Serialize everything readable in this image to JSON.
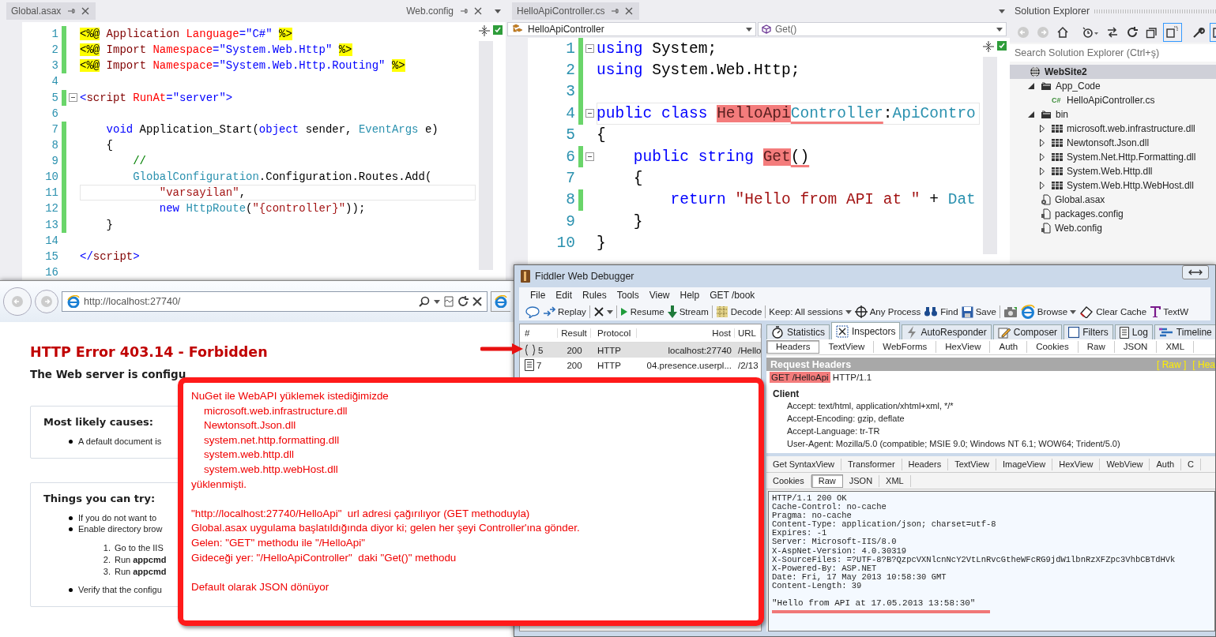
{
  "editor_left": {
    "tabs": [
      {
        "label": "Global.asax",
        "selected": true
      },
      {
        "label": "Web.config",
        "selected": false
      }
    ],
    "lines": [
      {
        "number": "1",
        "changed": true,
        "fold": false,
        "current": false,
        "tokens": [
          {
            "kind": "dir",
            "text": "<%@"
          },
          {
            "kind": "tag",
            "text": " Application "
          },
          {
            "kind": "attr",
            "text": "Language"
          },
          {
            "kind": "str",
            "text": "=\"C#\" "
          },
          {
            "kind": "dir",
            "text": "%>"
          }
        ]
      },
      {
        "number": "2",
        "changed": true,
        "fold": false,
        "current": false,
        "tokens": [
          {
            "kind": "dir",
            "text": "<%@"
          },
          {
            "kind": "tag",
            "text": " Import "
          },
          {
            "kind": "attr",
            "text": "Namespace"
          },
          {
            "kind": "str",
            "text": "=\"System.Web.Http\" "
          },
          {
            "kind": "dir",
            "text": "%>"
          }
        ]
      },
      {
        "number": "3",
        "changed": true,
        "fold": false,
        "current": false,
        "tokens": [
          {
            "kind": "dir",
            "text": "<%@"
          },
          {
            "kind": "tag",
            "text": " Import "
          },
          {
            "kind": "attr",
            "text": "Namespace"
          },
          {
            "kind": "str",
            "text": "=\"System.Web.Http.Routing\" "
          },
          {
            "kind": "dir",
            "text": "%>"
          }
        ]
      },
      {
        "number": "4",
        "changed": false,
        "fold": false,
        "current": false
      },
      {
        "number": "5",
        "changed": true,
        "fold": true,
        "current": false,
        "tokens": [
          {
            "kind": "str",
            "text": "<"
          },
          {
            "kind": "tag",
            "text": "script"
          },
          {
            "kind": "attr",
            "text": " RunAt"
          },
          {
            "kind": "str",
            "text": "=\"server\">"
          }
        ]
      },
      {
        "number": "6",
        "changed": false,
        "fold": false,
        "current": false
      },
      {
        "number": "7",
        "changed": true,
        "fold": false,
        "current": false,
        "tokens": [
          {
            "kind": "kw",
            "text": "    void"
          },
          {
            "kind": "plain",
            "text": " Application_Start("
          },
          {
            "kind": "kw",
            "text": "object"
          },
          {
            "kind": "plain",
            "text": " sender, "
          },
          {
            "kind": "type",
            "text": "EventArgs"
          },
          {
            "kind": "plain",
            "text": " e)"
          }
        ]
      },
      {
        "number": "8",
        "changed": true,
        "fold": false,
        "current": false,
        "tokens": [
          {
            "kind": "plain",
            "text": "    {"
          }
        ]
      },
      {
        "number": "9",
        "changed": true,
        "fold": false,
        "current": false,
        "tokens": [
          {
            "kind": "comment",
            "text": "        //"
          }
        ]
      },
      {
        "number": "10",
        "changed": true,
        "fold": false,
        "current": false,
        "tokens": [
          {
            "kind": "type",
            "text": "        GlobalConfiguration"
          },
          {
            "kind": "plain",
            "text": ".Configuration.Routes.Add("
          }
        ]
      },
      {
        "number": "11",
        "changed": true,
        "fold": false,
        "current": true,
        "tokens": [
          {
            "kind": "cstr",
            "text": "            \"varsayilan\""
          },
          {
            "kind": "plain",
            "text": ","
          }
        ]
      },
      {
        "number": "12",
        "changed": true,
        "fold": false,
        "current": false,
        "tokens": [
          {
            "kind": "kw",
            "text": "            new "
          },
          {
            "kind": "type",
            "text": "HttpRoute"
          },
          {
            "kind": "plain",
            "text": "("
          },
          {
            "kind": "cstr",
            "text": "\"{controller}\""
          },
          {
            "kind": "plain",
            "text": "));"
          }
        ]
      },
      {
        "number": "13",
        "changed": true,
        "fold": false,
        "current": false,
        "tokens": [
          {
            "kind": "plain",
            "text": "    }"
          }
        ]
      },
      {
        "number": "14",
        "changed": false,
        "fold": false,
        "current": false
      },
      {
        "number": "15",
        "changed": false,
        "fold": false,
        "current": false,
        "tokens": [
          {
            "kind": "str",
            "text": "</"
          },
          {
            "kind": "tag",
            "text": "script"
          },
          {
            "kind": "str",
            "text": ">"
          }
        ]
      },
      {
        "number": "16",
        "changed": false,
        "fold": false,
        "current": false
      }
    ]
  },
  "editor_right": {
    "tabs": [
      {
        "label": "HelloApiController.cs",
        "selected": true
      }
    ],
    "type_selector": "HelloApiController",
    "member_selector": "Get()",
    "lines": [
      {
        "number": "1",
        "changed": true,
        "fold": true,
        "current": false,
        "tokens": [
          {
            "kind": "kw",
            "text": "using"
          },
          {
            "kind": "plain",
            "text": " System;"
          }
        ]
      },
      {
        "number": "2",
        "changed": true,
        "fold": false,
        "current": false,
        "tokens": [
          {
            "kind": "kw",
            "text": "using"
          },
          {
            "kind": "plain",
            "text": " System.Web.Http;"
          }
        ]
      },
      {
        "number": "3",
        "changed": true,
        "fold": false,
        "current": false
      },
      {
        "number": "4",
        "changed": true,
        "fold": true,
        "current": true,
        "tokens": [
          {
            "kind": "kw",
            "text": "public class "
          },
          {
            "kind": "mark",
            "text": "HelloApi"
          },
          {
            "kind": "type_ul",
            "text": "Controller"
          },
          {
            "kind": "plain",
            "text": ":"
          },
          {
            "kind": "type",
            "text": "ApiContro"
          }
        ]
      },
      {
        "number": "5",
        "changed": false,
        "fold": false,
        "current": false,
        "tokens": [
          {
            "kind": "plain",
            "text": "{"
          }
        ]
      },
      {
        "number": "6",
        "changed": true,
        "fold": true,
        "current": false,
        "tokens": [
          {
            "kind": "kw",
            "text": "    public string "
          },
          {
            "kind": "mark",
            "text": "Get"
          },
          {
            "kind": "plain_ul",
            "text": "()"
          }
        ]
      },
      {
        "number": "7",
        "changed": false,
        "fold": false,
        "current": false,
        "tokens": [
          {
            "kind": "plain",
            "text": "    {"
          }
        ]
      },
      {
        "number": "8",
        "changed": true,
        "fold": false,
        "current": false,
        "tokens": [
          {
            "kind": "kw",
            "text": "        return "
          },
          {
            "kind": "cstr",
            "text": "\"Hello from API at \""
          },
          {
            "kind": "plain",
            "text": " + "
          },
          {
            "kind": "type",
            "text": "Dat"
          }
        ]
      },
      {
        "number": "9",
        "changed": false,
        "fold": false,
        "current": false,
        "tokens": [
          {
            "kind": "plain",
            "text": "    }"
          }
        ]
      },
      {
        "number": "10",
        "changed": false,
        "fold": false,
        "current": false,
        "tokens": [
          {
            "kind": "plain",
            "text": "}"
          }
        ]
      }
    ]
  },
  "solution_explorer": {
    "title": "Solution Explorer",
    "search": {
      "placeholder": "Search Solution Explorer (Ctrl+ş)"
    },
    "toolbar": [
      {
        "selected": false
      },
      {
        "selected": false
      },
      {
        "selected": false
      },
      {
        "selected": false
      },
      {
        "selected": false
      },
      {
        "selected": false
      },
      {
        "selected": false
      },
      {
        "selected": true
      },
      {
        "selected": false
      },
      {
        "selected": true
      }
    ],
    "tree": [
      {
        "label": "WebSite2",
        "kind": "project",
        "selected": true,
        "children": [
          {
            "label": "App_Code",
            "kind": "folder",
            "selected": false,
            "expanded": true,
            "children": [
              {
                "label": "HelloApiController.cs",
                "kind": "csharp",
                "badge": "C#",
                "selected": false
              }
            ]
          },
          {
            "label": "bin",
            "kind": "folder",
            "selected": false,
            "expanded": true,
            "children": [
              {
                "label": "microsoft.web.infrastructure.dll",
                "kind": "assembly",
                "selected": false,
                "expanded": false
              },
              {
                "label": "Newtonsoft.Json.dll",
                "kind": "assembly",
                "selected": false,
                "expanded": false
              },
              {
                "label": "System.Net.Http.Formatting.dll",
                "kind": "assembly",
                "selected": false,
                "expanded": false
              },
              {
                "label": "System.Web.Http.dll",
                "kind": "assembly",
                "selected": false,
                "expanded": false
              },
              {
                "label": "System.Web.Http.WebHost.dll",
                "kind": "assembly",
                "selected": false,
                "expanded": false
              }
            ]
          },
          {
            "label": "Global.asax",
            "kind": "asax",
            "selected": false
          },
          {
            "label": "packages.config",
            "kind": "config",
            "selected": false
          },
          {
            "label": "Web.config",
            "kind": "config",
            "selected": false
          }
        ]
      }
    ]
  },
  "browser": {
    "address": "http://localhost:27740/",
    "error_title": "HTTP Error 403.14 - Forbidden",
    "error_summary": "The Web server is configu",
    "sections": [
      {
        "heading": "Most likely causes:",
        "items": [
          {
            "kind": "bullet",
            "text": "A default document is"
          }
        ]
      },
      {
        "heading": "Things you can try:",
        "items": [
          {
            "kind": "bullet",
            "text": "If you do not want to"
          },
          {
            "kind": "bullet",
            "text": "Enable directory brow"
          },
          {
            "kind": "numbered",
            "number": "1.",
            "text": "Go to the IIS"
          },
          {
            "kind": "numbered",
            "number": "2.",
            "text": "Run **appcmd**"
          },
          {
            "kind": "numbered",
            "number": "3.",
            "text": "Run **appcmd**"
          },
          {
            "kind": "bullet",
            "text": "Verify that the configu"
          }
        ]
      }
    ]
  },
  "callout": {
    "paragraphs": [
      [
        {
          "text": "NuGet ile WebAPI yüklemek istediğimizde",
          "children": [
            {
              "text": "microsoft.web.infrastructure.dll"
            },
            {
              "text": "Newtonsoft.Json.dll"
            },
            {
              "text": "system.net.http.formatting.dll"
            },
            {
              "text": "system.web.http.dll"
            },
            {
              "text": "system.web.http.webHost.dll"
            }
          ]
        },
        {
          "text": "yüklenmişti."
        }
      ],
      [
        {
          "text": "\"http://localhost:27740/HelloApi\"  url adresi çağırılıyor (GET methoduyla)"
        },
        {
          "text": "Global.asax uygulama başlatıldığında diyor ki; gelen her şeyi Controller'ına gönder."
        },
        {
          "text": "Gelen: \"GET\" methodu ile \"/HelloApi\""
        },
        {
          "text": "Gideceği yer: \"/HelloApiController\"  daki \"Get()\" methodu"
        }
      ],
      [
        {
          "text": "Default olarak JSON dönüyor"
        }
      ]
    ]
  },
  "fiddler": {
    "title": "Fiddler Web Debugger",
    "menu": [
      "File",
      "Edit",
      "Rules",
      "Tools",
      "View",
      "Help",
      "GET /book"
    ],
    "toolbar": [
      {
        "dropdown": false
      },
      {
        "label": "Replay",
        "dropdown": false
      },
      {
        "dropdown": true
      },
      {
        "label": "Resume",
        "dropdown": false
      },
      {
        "label": "Stream",
        "dropdown": false
      },
      {
        "label": "Decode",
        "dropdown": false
      },
      {
        "label": "Keep: All sessions",
        "dropdown": true
      },
      {
        "label": "Any Process",
        "dropdown": false
      },
      {
        "label": "Find",
        "dropdown": false
      },
      {
        "label": "Save",
        "dropdown": false
      },
      {
        "dropdown": false
      },
      {
        "label": "Browse",
        "dropdown": true
      },
      {
        "label": "Clear Cache",
        "dropdown": false
      },
      {
        "label": "TextW",
        "dropdown": false
      }
    ],
    "sessions": {
      "columns": [
        "#",
        "Result",
        "Protocol",
        "Host",
        "URL"
      ],
      "rows": [
        {
          "kind": "json",
          "selected": true,
          "cells": [
            "5",
            "200",
            "HTTP",
            "localhost:27740",
            "/Hello"
          ]
        },
        {
          "kind": "doc",
          "selected": false,
          "cells": [
            "7",
            "200",
            "HTTP",
            "04.presence.userpl...",
            "/2/13"
          ]
        }
      ]
    },
    "inspector_tabs": [
      {
        "label": "Statistics",
        "selected": false
      },
      {
        "label": "Inspectors",
        "selected": true
      },
      {
        "label": "AutoResponder",
        "selected": false
      },
      {
        "label": "Composer",
        "selected": false
      },
      {
        "label": "Filters",
        "selected": false
      },
      {
        "label": "Log",
        "selected": false
      },
      {
        "label": "Timeline",
        "selected": false
      }
    ],
    "request_tabs": [
      {
        "label": "Headers",
        "selected": true
      },
      {
        "label": "TextView",
        "selected": false
      },
      {
        "label": "WebForms",
        "selected": false
      },
      {
        "label": "HexView",
        "selected": false
      },
      {
        "label": "Auth",
        "selected": false
      },
      {
        "label": "Cookies",
        "selected": false
      },
      {
        "label": "Raw",
        "selected": false
      },
      {
        "label": "JSON",
        "selected": false
      },
      {
        "label": "XML",
        "selected": false
      }
    ],
    "request": {
      "title": "Request Headers",
      "links": [
        "[ Raw ]",
        "[ Hea"
      ],
      "request_line": {
        "method_path": "GET /HelloApi",
        "version": "HTTP/1.1"
      },
      "groups": [
        {
          "title": "Client",
          "headers": [
            "Accept: text/html, application/xhtml+xml, */*",
            "Accept-Encoding: gzip, deflate",
            "Accept-Language: tr-TR",
            "User-Agent: Mozilla/5.0 (compatible; MSIE 9.0; Windows NT 6.1; WOW64; Trident/5.0)"
          ]
        }
      ]
    },
    "response_tabs": [
      [
        {
          "label": "Get SyntaxView",
          "selected": false
        },
        {
          "label": "Transformer",
          "selected": false
        },
        {
          "label": "Headers",
          "selected": false
        },
        {
          "label": "TextView",
          "selected": false
        },
        {
          "label": "ImageView",
          "selected": false
        },
        {
          "label": "HexView",
          "selected": false
        },
        {
          "label": "WebView",
          "selected": false
        },
        {
          "label": "Auth",
          "selected": false
        },
        {
          "label": "C",
          "selected": false
        }
      ],
      [
        {
          "label": "Cookies",
          "selected": false
        },
        {
          "label": "Raw",
          "selected": true
        },
        {
          "label": "JSON",
          "selected": false
        },
        {
          "label": "XML",
          "selected": false
        }
      ]
    ],
    "response_raw": [
      "HTTP/1.1 200 OK",
      "Cache-Control: no-cache",
      "Pragma: no-cache",
      "Content-Type: application/json; charset=utf-8",
      "Expires: -1",
      "Server: Microsoft-IIS/8.0",
      "X-AspNet-Version: 4.0.30319",
      "X-SourceFiles: =?UTF-8?B?QzpcVXNlcnNcY2VtLnRvcGtheWFcRG9jdW1lbnRzXFZpc3VhbCBTdHVk",
      "X-Powered-By: ASP.NET",
      "Date: Fri, 17 May 2013 10:58:30 GMT",
      "Content-Length: 39"
    ],
    "response_body": "\"Hello from API at 17.05.2013 13:58:30\""
  }
}
